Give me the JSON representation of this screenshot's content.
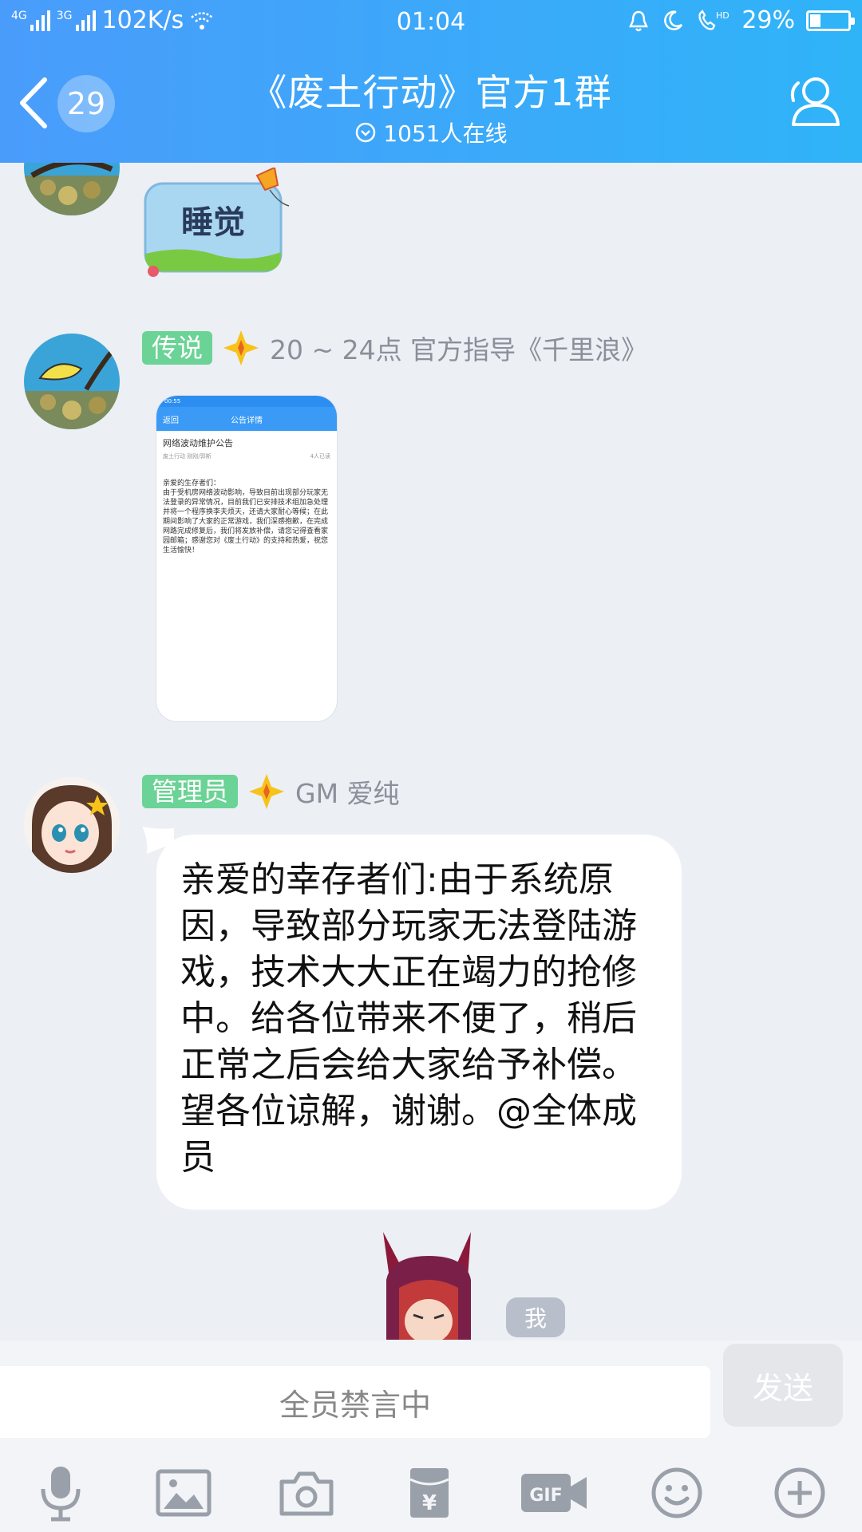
{
  "status_bar": {
    "network_1": "4G",
    "network_2": "3G",
    "speed": "102K/s",
    "time": "01:04",
    "hd": "HD",
    "battery_percent": "29%",
    "battery_level": 0.29
  },
  "header": {
    "unread_count": "29",
    "title": "《废土行动》官方1群",
    "online": "1051人在线",
    "colors": {
      "start": "#4a9cfb",
      "end": "#2fb4f8"
    }
  },
  "messages": [
    {
      "type": "sticker",
      "sticker_text": "睡觉"
    },
    {
      "type": "image",
      "role": "传说",
      "nickname": "20 ~ 24点 官方指导《千里浪》",
      "image": {
        "status_time": "00:55",
        "back": "返回",
        "nav_title": "公告详情",
        "heading": "网络波动维护公告",
        "meta_left": "废土行动  刚刚/郭斯",
        "meta_right": "4人已读",
        "body": "亲爱的生存者们：\n由于受机房网络波动影响，导致目前出现部分玩家无法登录的异常情况，目前我们已安排技术组加急处理并将一个程序换李夫烦天，还请大家耐心等候；在此期间影响了大家的正常游戏，我们深感抱歉，在完成网路完成修复后，我们将发放补偿，请您记得查看家园邮箱；感谢您对《废土行动》的支持和热爱，祝您生活愉快！"
      }
    },
    {
      "type": "text",
      "role": "管理员",
      "nickname": "GM 爱纯",
      "text": "亲爱的幸存者们:由于系统原因，导致部分玩家无法登陆游戏，技术大大正在竭力的抢修中。给各位带来不便了，稍后正常之后会给大家给予补偿。望各位谅解，谢谢。@全体成员"
    }
  ],
  "self_tag": "我",
  "input": {
    "placeholder": "全员禁言中",
    "send_label": "发送"
  },
  "toolbar": {
    "icons": [
      "microphone-icon",
      "image-icon",
      "camera-icon",
      "red-packet-icon",
      "gif-icon",
      "emoji-icon",
      "plus-icon"
    ]
  },
  "accent_colors": {
    "role_badge": "#6bd395",
    "bubble": "#ffffff",
    "background": "#eceff4"
  }
}
